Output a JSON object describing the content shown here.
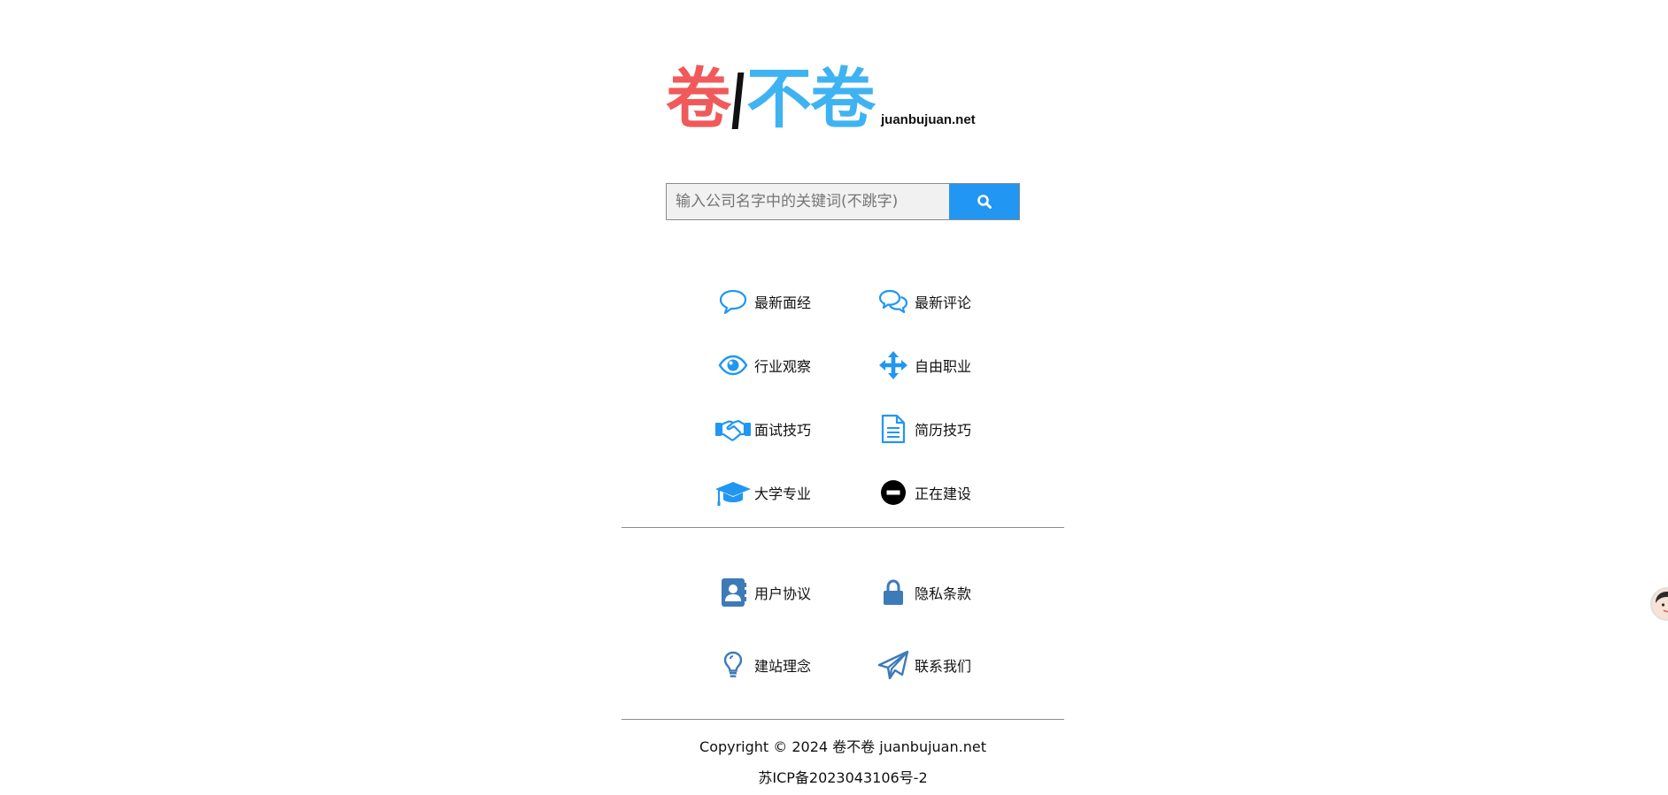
{
  "logo": {
    "char_red": "卷",
    "char_blue": "不卷",
    "domain": "juanbujuan.net"
  },
  "search": {
    "placeholder": "输入公司名字中的关键词(不跳字)",
    "value": "",
    "button_icon": "search-icon"
  },
  "menu": [
    {
      "label": "最新面经",
      "icon": "speech-bubble-icon"
    },
    {
      "label": "最新评论",
      "icon": "comments-icon"
    },
    {
      "label": "行业观察",
      "icon": "eye-icon"
    },
    {
      "label": "自由职业",
      "icon": "move-arrows-icon"
    },
    {
      "label": "面试技巧",
      "icon": "handshake-icon"
    },
    {
      "label": "简历技巧",
      "icon": "document-icon"
    },
    {
      "label": "大学专业",
      "icon": "graduation-cap-icon"
    },
    {
      "label": "正在建设",
      "icon": "minus-circle-icon"
    }
  ],
  "links": [
    {
      "label": "用户协议",
      "icon": "contact-book-icon"
    },
    {
      "label": "隐私条款",
      "icon": "lock-icon"
    },
    {
      "label": "建站理念",
      "icon": "lightbulb-icon"
    },
    {
      "label": "联系我们",
      "icon": "paper-plane-icon"
    }
  ],
  "footer": {
    "copyright": "Copyright © 2024 卷不卷 juanbujuan.net",
    "icp": "苏ICP备2023043106号-2"
  },
  "colors": {
    "brand_blue": "#2196f3",
    "logo_red": "#f05a5a",
    "logo_blue": "#3fb3f2",
    "link_icon": "#3d7ab8"
  }
}
